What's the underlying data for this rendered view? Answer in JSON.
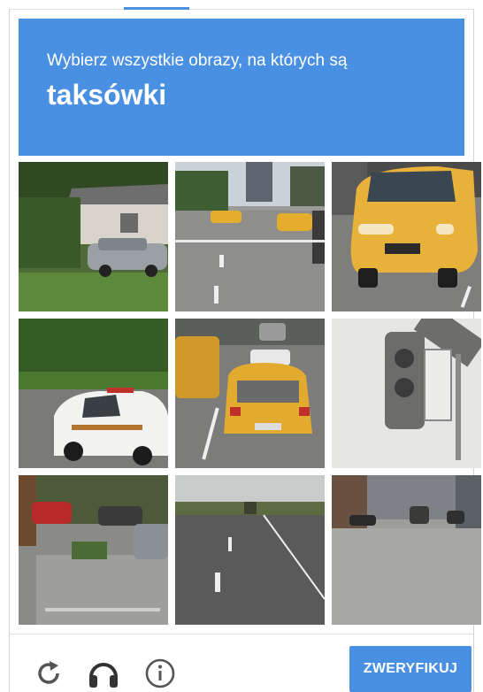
{
  "header": {
    "instruction": "Wybierz wszystkie obrazy, na których są",
    "target": "taksówki"
  },
  "colors": {
    "accent": "#4a90e2",
    "taxi_yellow": "#e8b23a"
  },
  "tiles": [
    {
      "scene": "house-with-silver-car"
    },
    {
      "scene": "street-with-taxis"
    },
    {
      "scene": "taxi-front-closeup"
    },
    {
      "scene": "police-car"
    },
    {
      "scene": "taxi-rear-traffic"
    },
    {
      "scene": "traffic-light"
    },
    {
      "scene": "parked-cars-trees"
    },
    {
      "scene": "empty-highway"
    },
    {
      "scene": "city-street"
    }
  ],
  "footer": {
    "reload_icon": "reload-icon",
    "audio_icon": "headphones-icon",
    "info_icon": "info-icon",
    "verify_label": "ZWERYFIKUJ"
  }
}
